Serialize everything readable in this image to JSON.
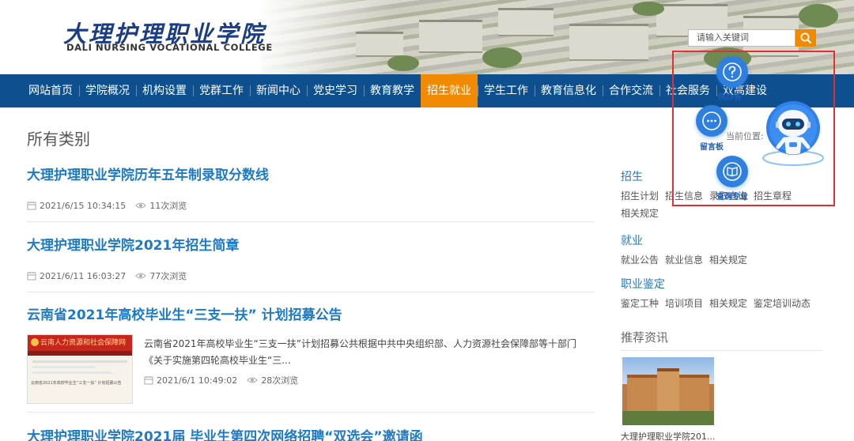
{
  "header": {
    "logo_cn": "大理护理职业学院",
    "logo_en": "DALI NURSING VOCATIONAL COLLEGE",
    "search_placeholder": "请输入关键词",
    "brand_color": "#0d4f8f",
    "accent_color": "#f18a00"
  },
  "nav": {
    "items": [
      "网站首页",
      "学院概况",
      "机构设置",
      "党群工作",
      "新闻中心",
      "党史学习",
      "教育教学",
      "招生就业",
      "学生工作",
      "教育信息化",
      "合作交流",
      "社会服务",
      "双高建设"
    ],
    "active": "招生就业"
  },
  "main": {
    "title": "所有类别",
    "articles": [
      {
        "title": "大理护理职业学院历年五年制录取分数线",
        "date": "2021/6/15 10:34:15",
        "views": "11次浏览"
      },
      {
        "title": "大理护理职业学院2021年招生简章",
        "date": "2021/6/11 16:03:27",
        "views": "77次浏览"
      },
      {
        "title": "云南省2021年高校毕业生“三支一扶” 计划招募公告",
        "summary_1": "云南省2021年高校毕业生“三支一扶”计划招募公共根据中共中央组织部、人力资源社会保障部等十部门",
        "summary_2": "《关于实施第四轮高校毕业生“三...",
        "date": "2021/6/1 10:49:02",
        "views": "28次浏览",
        "thumb_banner": "云南人力资源和社会保障网",
        "thumb_caption": "云南省2021年高校毕业生“三支一扶” 计划招募公告"
      },
      {
        "title": "大理护理职业学院2021届 毕业生第四次网络招聘“双选会”邀请函"
      }
    ]
  },
  "sidebar": {
    "sections": [
      {
        "heading": "招生",
        "links": [
          "招生计划",
          "招生信息",
          "录取查询",
          "招生章程",
          "相关规定"
        ]
      },
      {
        "heading": "就业",
        "links": [
          "就业公告",
          "就业信息",
          "相关规定"
        ]
      },
      {
        "heading": "职业鉴定",
        "links": [
          "鉴定工种",
          "培训项目",
          "相关规定",
          "鉴定培训动态"
        ]
      }
    ],
    "recommend_title": "推荐资讯",
    "recommend_caption": "大理护理职业学院201..."
  },
  "widget": {
    "faq_label": "院办答",
    "message_label": "留言板",
    "major_label": "查询专业",
    "breadcrumb": "当前位置:"
  }
}
